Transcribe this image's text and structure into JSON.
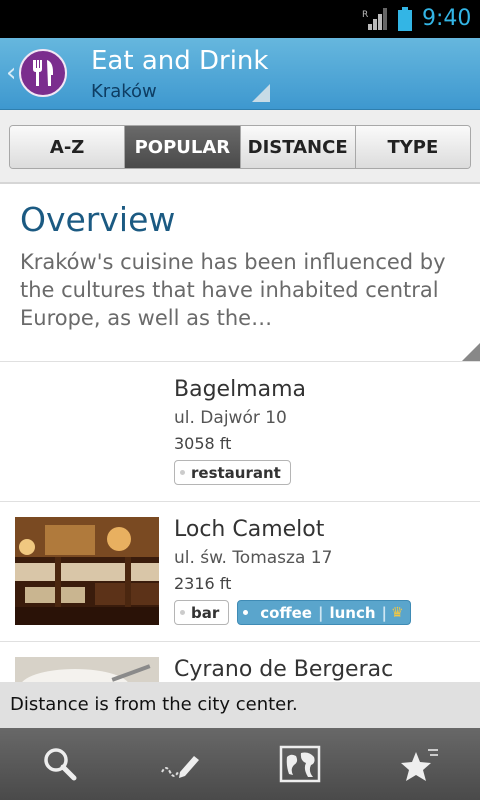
{
  "status_bar": {
    "time": "9:40",
    "roaming_indicator": "R",
    "icons": [
      "signal-icon",
      "battery-icon"
    ]
  },
  "header": {
    "title": "Eat and Drink",
    "subtitle": "Kraków",
    "icon": "fork-knife-icon",
    "back_icon": "chevron-left-icon",
    "colors": {
      "bar": "#4aa5d6",
      "logo": "#7b2d8e"
    }
  },
  "tabs": [
    {
      "label": "A-Z",
      "active": false
    },
    {
      "label": "POPULAR",
      "active": true
    },
    {
      "label": "DISTANCE",
      "active": false
    },
    {
      "label": "TYPE",
      "active": false
    }
  ],
  "overview": {
    "title": "Overview",
    "text": "Kraków's cuisine has been influenced by the cultures that have inhabited central Europe, as well as the…"
  },
  "listings": [
    {
      "name": "Bagelmama",
      "address": "ul. Dajwór 10",
      "distance": "3058 ft",
      "tags": [
        "restaurant"
      ],
      "highlight_tags": []
    },
    {
      "name": "Loch Camelot",
      "address": "ul. św. Tomasza 17",
      "distance": "2316 ft",
      "tags": [
        "bar"
      ],
      "highlight_tags": [
        "coffee",
        "lunch"
      ]
    },
    {
      "name": "Cyrano de Bergerac",
      "address": "",
      "distance": "",
      "tags": [],
      "highlight_tags": []
    }
  ],
  "toast": {
    "text": "Distance is from the city center."
  },
  "bottom_nav": [
    "search-icon",
    "write-review-icon",
    "map-icon",
    "favorites-icon"
  ]
}
